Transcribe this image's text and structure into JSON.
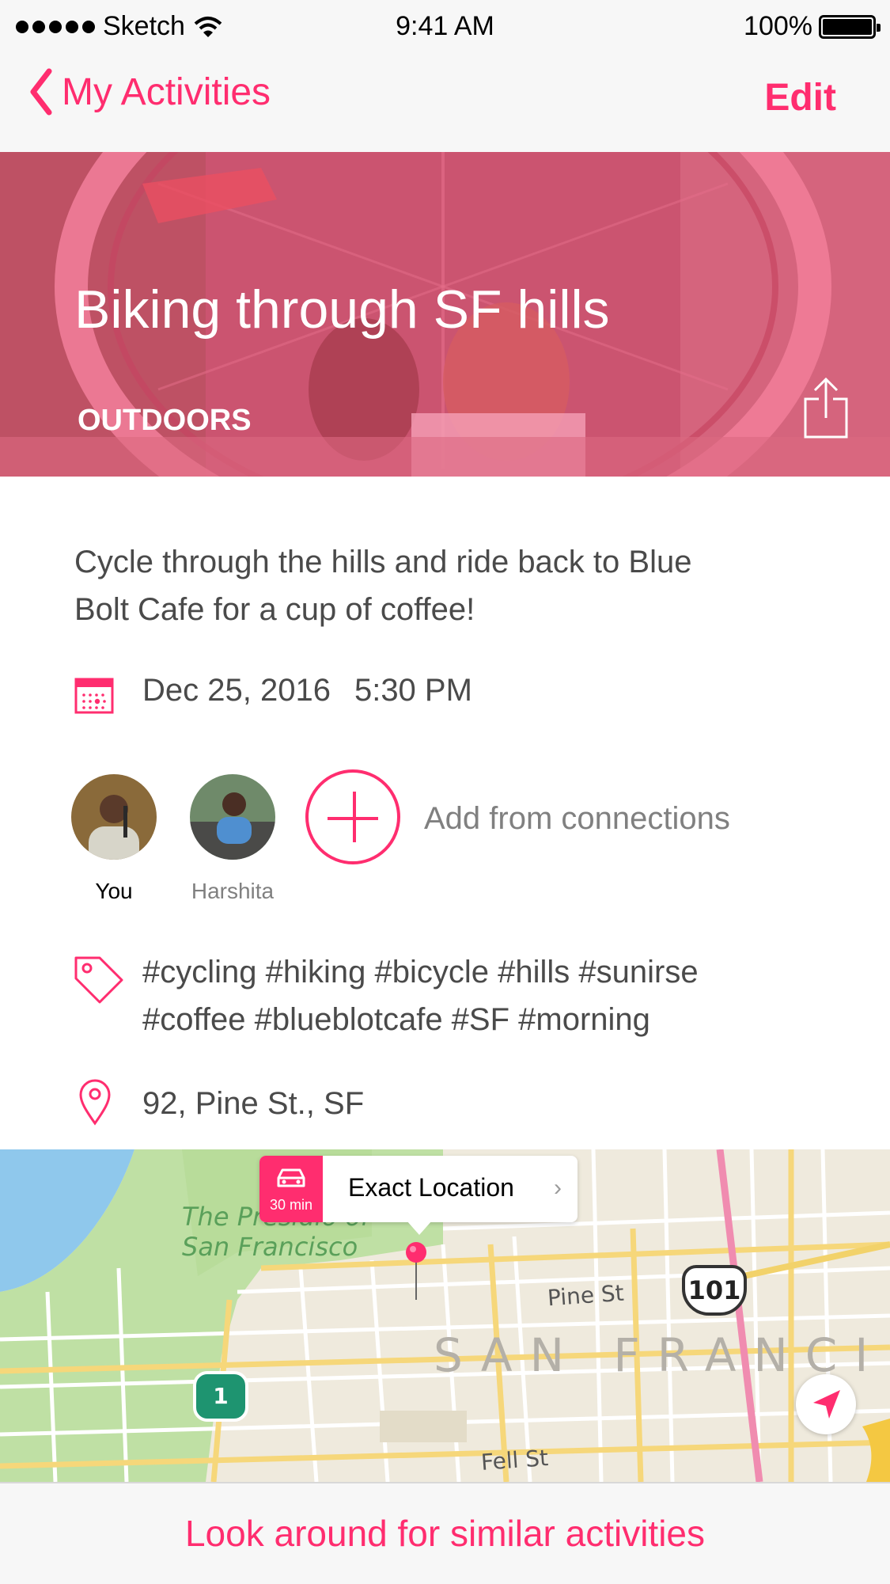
{
  "status_bar": {
    "carrier": "Sketch",
    "time": "9:41 AM",
    "battery": "100%",
    "battery_level": 1.0
  },
  "nav": {
    "back_label": "My Activities",
    "edit_label": "Edit"
  },
  "activity": {
    "title": "Biking through SF hills",
    "category": "OUTDOORS",
    "description": "Cycle through the hills and ride back to Blue Bolt Cafe for a cup of coffee!",
    "date": "Dec 25, 2016",
    "time": "5:30 PM",
    "participants": [
      {
        "name": "You"
      },
      {
        "name": "Harshita"
      }
    ],
    "add_label": "Add from connections",
    "tags": "#cycling #hiking #bicycle #hills #sunirse #coffee #blueblotcafe #SF #morning",
    "address": "92, Pine St., SF"
  },
  "map": {
    "callout_time": "30 min",
    "callout_label": "Exact Location",
    "labels": {
      "park": "The Presidio of",
      "park2": "San Francisco",
      "pine": "Pine St",
      "city": "SAN FRANCI",
      "fell": "Fell St",
      "hwy101": "101",
      "hwy1": "1"
    }
  },
  "footer": {
    "label": "Look around for similar activities"
  },
  "colors": {
    "accent": "#ff2d6f",
    "text": "#4a4a4a",
    "muted": "#808080",
    "bar_bg": "#f7f7f7"
  },
  "icons": [
    "chevron-left-icon",
    "share-icon",
    "calendar-icon",
    "tag-icon",
    "location-pin-icon",
    "car-icon",
    "chevron-right-icon",
    "navigation-arrow-icon",
    "wifi-icon",
    "battery-icon"
  ]
}
